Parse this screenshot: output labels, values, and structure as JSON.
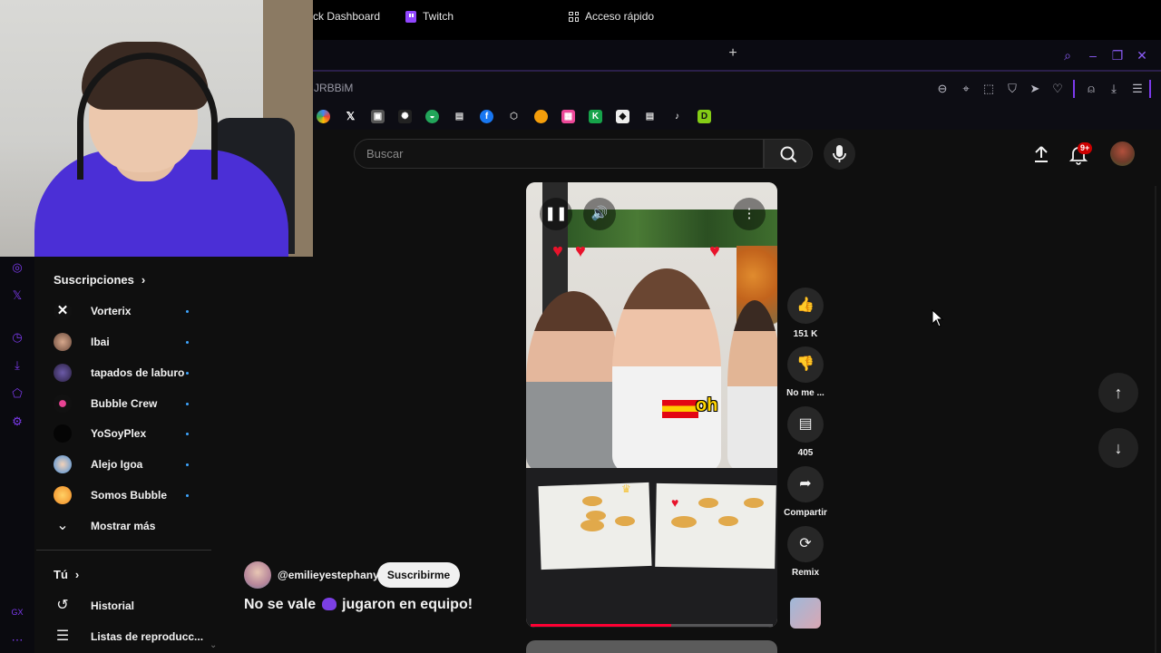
{
  "browser": {
    "tabs": [
      {
        "label": "ck Dashboard"
      },
      {
        "label": "Twitch"
      },
      {
        "label": "Acceso rápido"
      }
    ],
    "address_text": "JRBBiM",
    "accent_color": "#7c3aed"
  },
  "header": {
    "search_placeholder": "Buscar",
    "notification_badge": "9+"
  },
  "sidebar": {
    "subscriptions_heading": "Suscripciones",
    "subscriptions": [
      {
        "label": "Vorterix"
      },
      {
        "label": "Ibai"
      },
      {
        "label": "tapados de laburo"
      },
      {
        "label": "Bubble Crew"
      },
      {
        "label": "YoSoyPlex"
      },
      {
        "label": "Alejo Igoa"
      },
      {
        "label": "Somos Bubble"
      }
    ],
    "show_more": "Mostrar más",
    "you_heading": "Tú",
    "you_items": [
      {
        "label": "Historial"
      },
      {
        "label": "Listas de reproducc..."
      }
    ]
  },
  "short": {
    "overlay_text": "oh",
    "channel": "@emilieyestephany",
    "subscribe_label": "Suscribirme",
    "title_part1": "No se vale",
    "title_part2": "jugaron en equipo!",
    "progress": 0.58
  },
  "actions": {
    "like_count": "151 K",
    "dislike_label": "No me ...",
    "comment_count": "405",
    "share_label": "Compartir",
    "remix_label": "Remix"
  }
}
